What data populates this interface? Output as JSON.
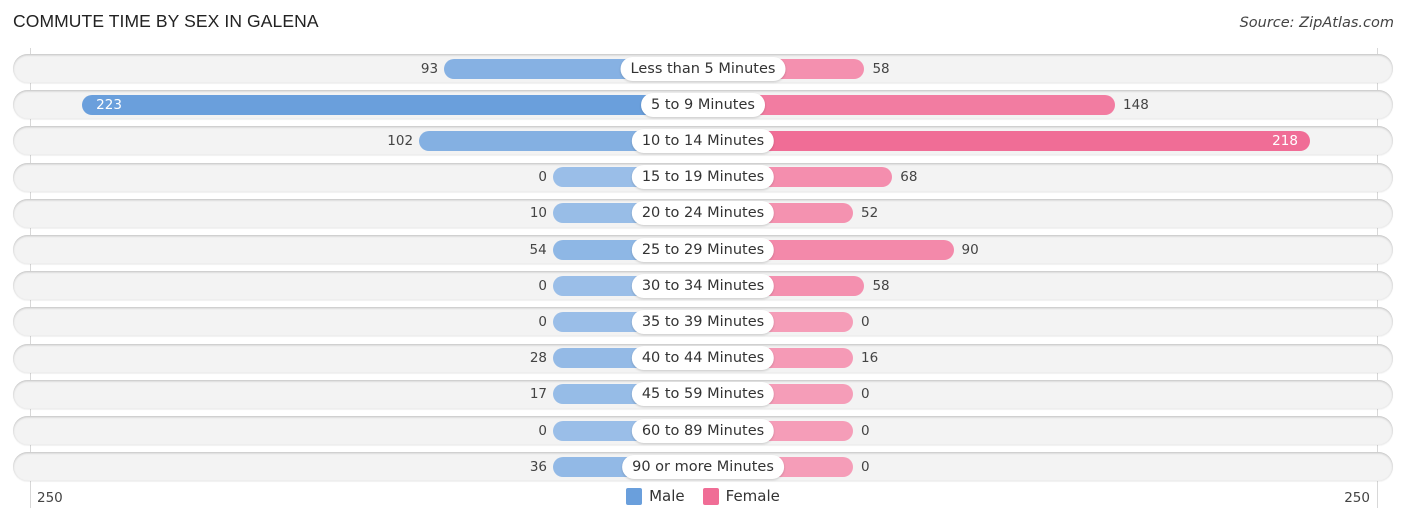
{
  "chart_data": {
    "type": "bar",
    "orientation": "horizontal-diverging",
    "title": "COMMUTE TIME BY SEX IN GALENA",
    "source": "Source: ZipAtlas.com",
    "categories": [
      "Less than 5 Minutes",
      "5 to 9 Minutes",
      "10 to 14 Minutes",
      "15 to 19 Minutes",
      "20 to 24 Minutes",
      "25 to 29 Minutes",
      "30 to 34 Minutes",
      "35 to 39 Minutes",
      "40 to 44 Minutes",
      "45 to 59 Minutes",
      "60 to 89 Minutes",
      "90 or more Minutes"
    ],
    "series": [
      {
        "name": "Male",
        "color": "#6a9fdc",
        "values": [
          93,
          223,
          102,
          0,
          10,
          54,
          0,
          0,
          28,
          17,
          0,
          36
        ]
      },
      {
        "name": "Female",
        "color": "#f06d96",
        "values": [
          58,
          148,
          218,
          68,
          52,
          90,
          58,
          0,
          16,
          0,
          0,
          0
        ]
      }
    ],
    "axis": {
      "min_label": "250",
      "max_label": "250",
      "range": [
        0,
        250
      ]
    },
    "legend": {
      "position": "bottom-center",
      "items": [
        "Male",
        "Female"
      ]
    },
    "grid": false
  }
}
